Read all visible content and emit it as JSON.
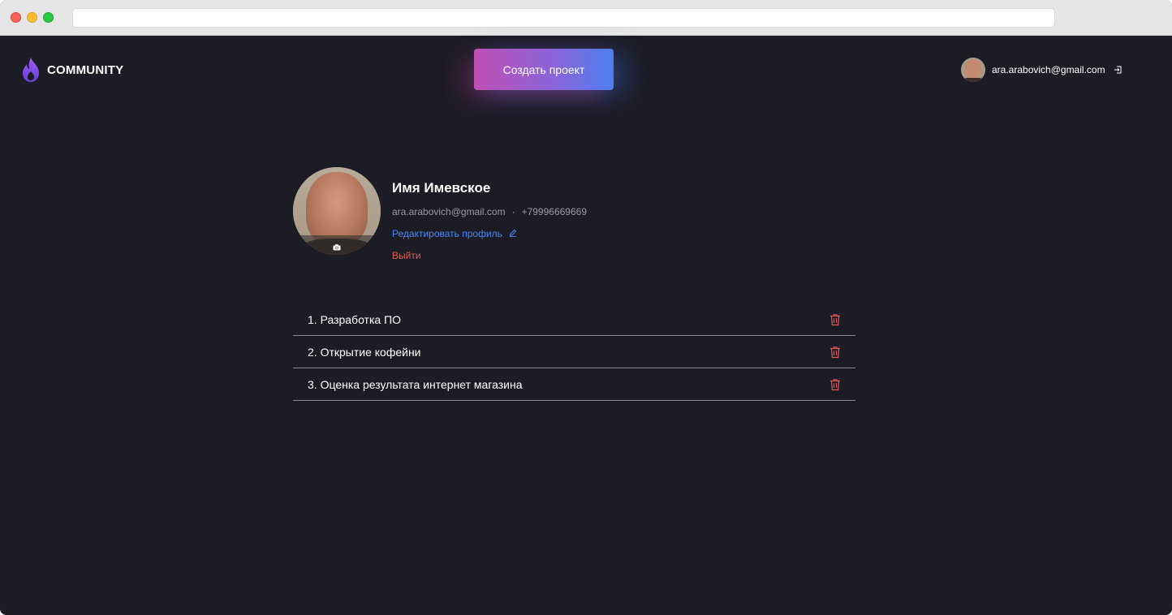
{
  "header": {
    "logo_text": "COMMUNITY",
    "logo_icon": "flame-icon",
    "create_button_label": "Создать проект",
    "user_email": "ara.arabovich@gmail.com",
    "logout_icon": "logout-icon"
  },
  "profile": {
    "name": "Имя Имевское",
    "email": "ara.arabovich@gmail.com",
    "separator": "·",
    "phone": "+79996669669",
    "edit_label": "Редактировать профиль",
    "logout_label": "Выйти",
    "camera_icon": "camera-icon"
  },
  "projects": [
    {
      "title": "1. Разработка ПО"
    },
    {
      "title": "2. Открытие кофейни"
    },
    {
      "title": "3. Оценка результата интернет магазина"
    }
  ],
  "colors": {
    "background": "#1c1c24",
    "accent_blue": "#4a86f7",
    "danger_red": "#e05a5a",
    "gradient_start": "#c04fb4",
    "gradient_end": "#4f7ff0",
    "logo_purple": "#7b4fe0"
  }
}
